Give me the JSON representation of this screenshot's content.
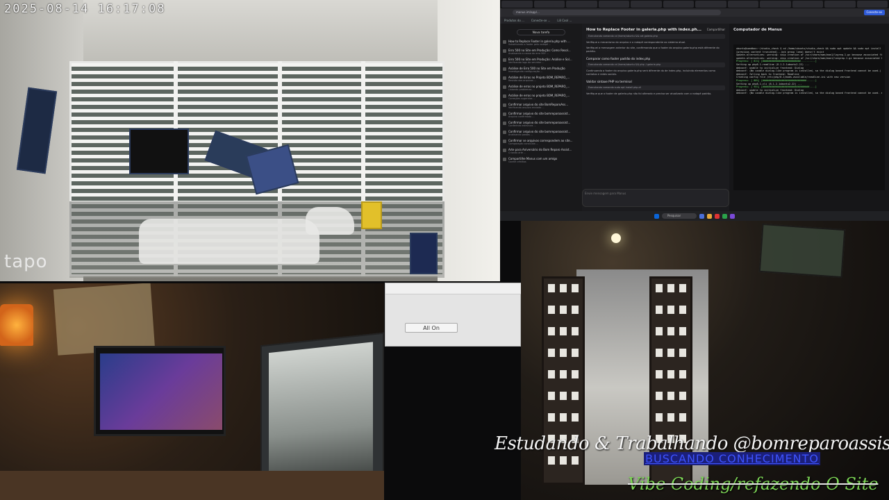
{
  "camera": {
    "timestamp": "2025-08-14  16:17:08",
    "brand": "tapo"
  },
  "browser": {
    "url": "manus.im/app/...",
    "share_button": "Conecte-se",
    "bookmarks": [
      "Produtos do ...",
      "Conecte-se ...",
      "Lili Cool ..."
    ]
  },
  "chat_sidebar": {
    "new_task": "Nova tarefa",
    "items": [
      {
        "title": "How to Replace Footer in galeria.php with ...",
        "sub": "Substituindo o footer pelo rodapé ..."
      },
      {
        "title": "Erro 500 no Site em Produção: Como Resol...",
        "sub": "Analisando a causa do erro 500 ..."
      },
      {
        "title": "Erro 500 no Site em Produção: Análise e Sol...",
        "sub": "Verificando logs do servidor ..."
      },
      {
        "title": "Análise de Erro 500 no Site em Produção",
        "sub": "Investigando configuração ..."
      },
      {
        "title": "Análise de Erros no Projeto BOM_REPARO_...",
        "sub": "Revisão dos arquivos ..."
      },
      {
        "title": "Análise de erros no projeto BOM_REPARO_...",
        "sub": "Listando problemas ..."
      },
      {
        "title": "Análise de erros no projeto BOM_REPARO_...",
        "sub": "Correções sugeridas ..."
      },
      {
        "title": "Confirmar arquivo do site BomReparoAss...",
        "sub": "Verificando arquivo enviado ..."
      },
      {
        "title": "Confirmar arquivo do site bomreparoassist...",
        "sub": "Arquivo confirmado ..."
      },
      {
        "title": "Confirmar arquivo do site bomreparoassist...",
        "sub": "Conferindo estrutura ..."
      },
      {
        "title": "Confirmar arquivo do site bomreparoassist...",
        "sub": "Analisando pastas ..."
      },
      {
        "title": "Confirmar se arquivos correspondem ao site...",
        "sub": "Comparação concluída ..."
      },
      {
        "title": "Arte para Aniversário do Bom Reparo Assist...",
        "sub": "Criando arte ..."
      },
      {
        "title": "Compartilhe Manus com um amigo",
        "sub": "Ganhe créditos"
      }
    ]
  },
  "chat_main": {
    "title": "How to Replace Footer in galeria.php with index.ph...",
    "share": "Compartilhar",
    "paragraphs": [
      "Verifique o mecanismo do arquivo e o rodapé correspondente ao sistema atual.",
      "Verifiquei a mensagem anterior do site, confirmando que o footer do arquivo galeria.php está diferente do padrão.",
      "Continuando o footer do arquivo galeria.php será diferente do de index.php, incluindo elementos como contatos e redes sociais.",
      "Verifique que o footer de galeria.php não foi alterado e precisa ser atualizado com o rodapé padrão."
    ],
    "headings": [
      "Comparar como footer padrão do index.php",
      "Validar sintaxe PHP no terminal"
    ],
    "codes": [
      "Executando comando cd /home/ubuntu && cat galeria.php",
      "Executando comando cd /home/ubuntu && php -l galeria.php",
      "Executando comando sudo apt install php-cli"
    ],
    "input_placeholder": "Envie mensagem para Manus"
  },
  "terminal": {
    "title": "Computador de Manus",
    "lines": [
      "ubuntu@sandbox:~/studio_check $ cd /home/ubuntu/studio_check && sudo apt update && sudo apt install -y php-cli",
      "[previous content truncated]...bck group lzma) doesn't exist",
      "update-alternatives: warning: skip creation of /usr/share/man/man1/lzgrep.1.gz because associated file /usr/share/man/man1/xzgrep.1.gz (of link group lzma) doesn't exist",
      "update-alternatives: warning: skip creation of /usr/share/man/man1/lzegrep.1.gz because associated file doesn't exist",
      "Progress: [ 81%] [##########################..........] ",
      "Setting up php8.1-readline (8.1.2-1ubuntu2.22) ...",
      "debconf: unable to initialize frontend: Dialog",
      "debconf: (No usable dialog-like program is installed, so the dialog based frontend cannot be used.)",
      "debconf: falling back to frontend: Readline",
      "Creating config file /etc/php/8.1/mods-available/readline.ini with new version",
      "Progress: [ 88%] [##############################......] ",
      "Setting up php8.1-cli (8.1.2-1ubuntu2.22) ...",
      "Progress: [ 94%] [################################....] ",
      "debconf: unable to initialize frontend: Dialog",
      "debconf: (No usable dialog-like program is installed, so the dialog based frontend cannot be used. at /usr/share/perl5/Debconf/FrontEnd/Dialog.pm line 78.)"
    ]
  },
  "taskbar": {
    "search": "Pesquisar"
  },
  "overlay": {
    "button": "All On"
  },
  "captions": {
    "line1": "Estudando & Trabalhando @bomreparoassistencia",
    "line2": "BUSCANDO CONHECIMENTO",
    "line3": "Vibe Coding/refazendo O Site"
  }
}
